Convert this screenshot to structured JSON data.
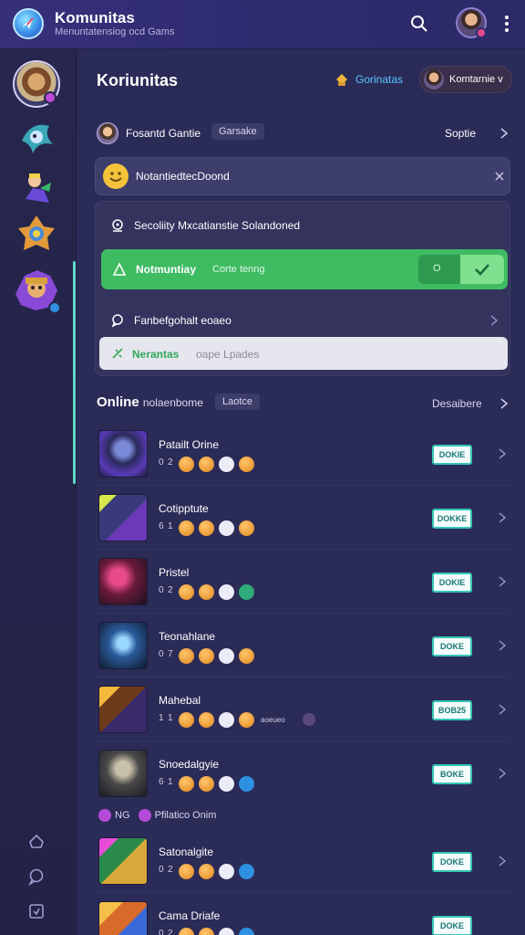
{
  "header": {
    "title": "Komunitas",
    "subtitle": "Menuntatensiog ocd Gams",
    "icons": {
      "search": "search-icon",
      "more": "more-vertical-icon"
    }
  },
  "rail": {
    "items": [
      {
        "name": "rail-game-1",
        "icon": "hero-avatar-icon"
      },
      {
        "name": "rail-game-2",
        "icon": "hero-avatar-icon"
      },
      {
        "name": "rail-game-3",
        "icon": "hero-avatar-icon"
      },
      {
        "name": "rail-game-4",
        "icon": "hero-avatar-icon"
      },
      {
        "name": "rail-game-5",
        "icon": "hero-avatar-icon"
      }
    ],
    "footer_icons": [
      "home-icon",
      "chat-icon",
      "settings-icon"
    ]
  },
  "main": {
    "title": "Koriunitas",
    "coins_label": "Gorinatas",
    "user_chip": "Komtarnie v",
    "section": {
      "label": "Fosantd Gantie",
      "tag": "Garsake",
      "action": "Soptie"
    },
    "notice": "NotantiedtecDoond",
    "options": {
      "row_a": "Secoliity Mxcatianstie Solandoned",
      "row_b_title": "Notmuntiay",
      "row_b_sub": "Corte tenng",
      "toggle_off_label": "O",
      "row_c": "Fanbefgohalt eoaeo",
      "row_d_title": "Nerantas",
      "row_d_sub": "oape Lpades"
    },
    "online": {
      "title": "Online",
      "title_rest": "nolaenbome",
      "tag": "Laotce",
      "action": "Desaibere"
    },
    "games": [
      {
        "title": "Patailt Orine",
        "n1": "0",
        "n2": "2",
        "chips": [
          "orange",
          "orange",
          "white",
          "orange"
        ],
        "join": "DOKIE"
      },
      {
        "title": "Cotipptute",
        "n1": "6",
        "n2": "1",
        "chips": [
          "orange",
          "orange",
          "white",
          "orange"
        ],
        "join": "DOKKE"
      },
      {
        "title": "Pristel",
        "n1": "0",
        "n2": "2",
        "chips": [
          "orange",
          "orange",
          "white",
          "green"
        ],
        "join": "DOKIE"
      },
      {
        "title": "Teonahlane",
        "n1": "0",
        "n2": "7",
        "chips": [
          "orange",
          "orange",
          "white",
          "orange"
        ],
        "join": "DOKE"
      },
      {
        "title": "Mahebal",
        "n1": "1",
        "n2": "1",
        "chips": [
          "orange",
          "orange",
          "white",
          "orange"
        ],
        "join": "BOB25"
      },
      {
        "title": "Snoedalgyie",
        "n1": "6",
        "n2": "1",
        "chips": [
          "orange",
          "orange",
          "white",
          "blue"
        ],
        "join": "BOKE"
      },
      {
        "title": "Satonalgite",
        "n1": "0",
        "n2": "2",
        "chips": [
          "orange",
          "orange",
          "white",
          "blue"
        ],
        "join": "DOKE"
      },
      {
        "title": "Cama Driafe",
        "n1": "0",
        "n2": "2",
        "chips": [
          "orange",
          "orange",
          "white",
          "blue"
        ],
        "join": "DOKE"
      }
    ],
    "party_line": {
      "tag": "NG",
      "text": "Pfilatico Onim"
    },
    "extra_labels": {
      "row5": "aoeueo"
    }
  },
  "colors": {
    "accent_green": "#3fbb62",
    "accent_teal": "#35c7b4",
    "coins": "#57c7ff",
    "background": "#2b2b58"
  }
}
